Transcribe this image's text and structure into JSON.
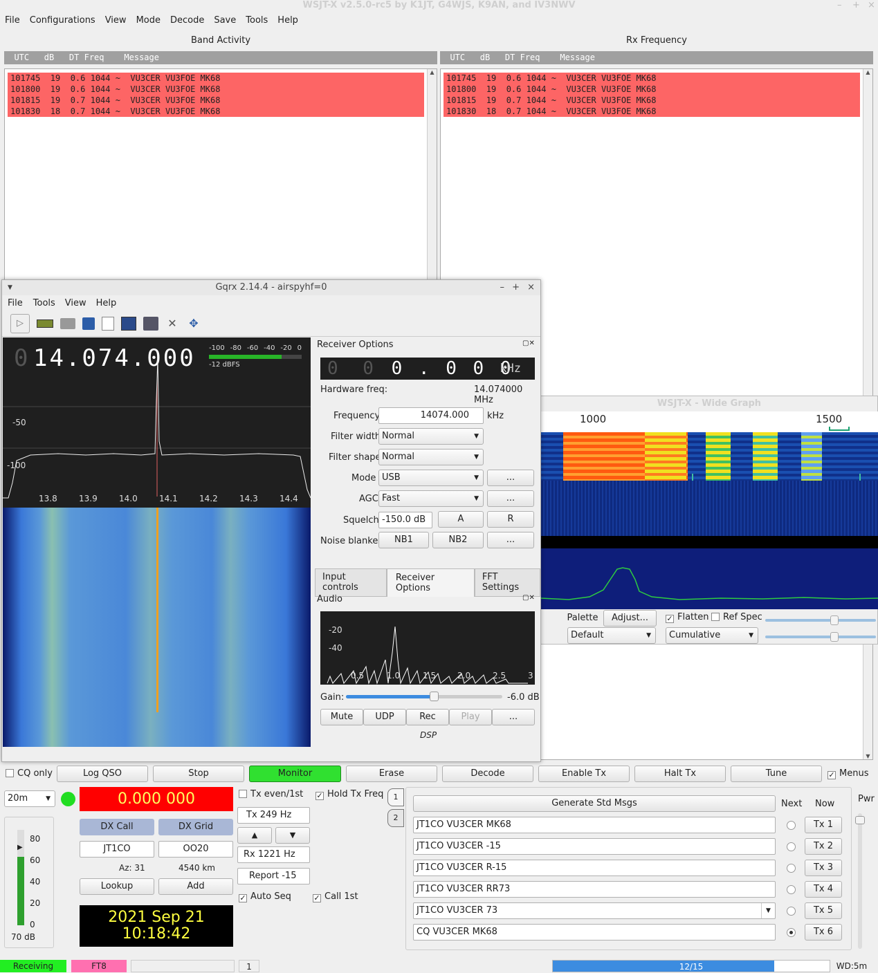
{
  "app_title": "WSJT-X   v2.5.0-rc5   by K1JT, G4WJS, K9AN, and IV3NWV",
  "menu": [
    "File",
    "Configurations",
    "View",
    "Mode",
    "Decode",
    "Save",
    "Tools",
    "Help"
  ],
  "band_activity": {
    "title": "Band Activity",
    "header": "  UTC   dB   DT Freq    Message",
    "rows": [
      "101745  19  0.6 1044 ~  VU3CER VU3FOE MK68",
      "101800  19  0.6 1044 ~  VU3CER VU3FOE MK68",
      "101815  19  0.7 1044 ~  VU3CER VU3FOE MK68",
      "101830  18  0.7 1044 ~  VU3CER VU3FOE MK68"
    ]
  },
  "rx_frequency": {
    "title": "Rx Frequency",
    "header": "  UTC   dB   DT Freq    Message",
    "rows": [
      "101745  19  0.6 1044 ~  VU3CER VU3FOE MK68",
      "101800  19  0.6 1044 ~  VU3CER VU3FOE MK68",
      "101815  19  0.7 1044 ~  VU3CER VU3FOE MK68",
      "101830  18  0.7 1044 ~  VU3CER VU3FOE MK68"
    ]
  },
  "gqrx": {
    "title": "Gqrx 2.14.4 - airspyhf=0",
    "menu": [
      "File",
      "Tools",
      "View",
      "Help"
    ],
    "freq_dim": "0",
    "freq_main": "14.074.000",
    "meter_scale": [
      "-100",
      "-80",
      "-60",
      "-40",
      "-20",
      "0"
    ],
    "meter_label": "-12 dBFS",
    "meter_level_fraction": 0.78,
    "spectrum_y": [
      "-50",
      "-100"
    ],
    "spectrum_x": [
      "13.8",
      "13.9",
      "14.0",
      "14.1",
      "14.2",
      "14.3",
      "14.4"
    ],
    "receiver_options": {
      "title": "Receiver Options",
      "offset_dim": "0 0",
      "offset_main": "0 . 0 0 0",
      "offset_unit": "kHz",
      "hw_label": "Hardware freq:",
      "hw_value": "14.074000 MHz",
      "frequency_label": "Frequency",
      "frequency_value": "14074.000",
      "frequency_unit": "kHz",
      "filter_width_label": "Filter width",
      "filter_width": "Normal",
      "filter_shape_label": "Filter shape",
      "filter_shape": "Normal",
      "mode_label": "Mode",
      "mode": "USB",
      "agc_label": "AGC",
      "agc": "Fast",
      "squelch_label": "Squelch",
      "squelch": "-150.0 dB",
      "btn_a": "A",
      "btn_r": "R",
      "nb_label": "Noise blanker",
      "nb1": "NB1",
      "nb2": "NB2",
      "more": "..."
    },
    "tabs": [
      "Input controls",
      "Receiver Options",
      "FFT Settings"
    ],
    "audio": {
      "title": "Audio",
      "y": [
        "-20",
        "-40"
      ],
      "x": [
        "0.5",
        "1.0",
        "1.5",
        "2.0",
        "2.5",
        "3"
      ],
      "gain_label": "Gain:",
      "gain_value": "-6.0 dB",
      "gain_fraction": 0.56,
      "buttons": [
        "Mute",
        "UDP",
        "Rec",
        "Play",
        "..."
      ],
      "dsp": "DSP"
    }
  },
  "wide_graph": {
    "title": "WSJT-X - Wide Graph",
    "scale": [
      "1000",
      "1500"
    ],
    "palette_label": "Palette",
    "adjust": "Adjust...",
    "flatten": "Flatten",
    "ref_spec": "Ref Spec",
    "palette_value": "Default",
    "cumulative": "Cumulative"
  },
  "controls": {
    "cq_only": "CQ only",
    "log_qso": "Log QSO",
    "stop": "Stop",
    "monitor": "Monitor",
    "erase": "Erase",
    "decode": "Decode",
    "enable_tx": "Enable Tx",
    "halt_tx": "Halt Tx",
    "tune": "Tune",
    "menus": "Menus",
    "band": "20m",
    "dial_freq": "0.000 000",
    "dx_call_label": "DX Call",
    "dx_grid_label": "DX Grid",
    "dx_call": "JT1CO",
    "dx_grid": "OO20",
    "az": "Az: 31",
    "distance": "4540 km",
    "lookup": "Lookup",
    "add": "Add",
    "date": "2021 Sep 21",
    "time": "10:18:42",
    "level_scale": [
      "80",
      "60",
      "40",
      "20",
      "0"
    ],
    "level_label": "70 dB",
    "level_fraction": 0.72,
    "tx_even": "Tx even/1st",
    "hold_tx": "Hold Tx Freq",
    "tx_freq": "Tx  249  Hz",
    "rx_freq": "Rx  1221  Hz",
    "report": "Report -15",
    "auto_seq": "Auto Seq",
    "call_1st": "Call 1st",
    "tab1": "1",
    "tab2": "2",
    "generate": "Generate Std Msgs",
    "next": "Next",
    "now": "Now",
    "pwr": "Pwr",
    "messages": [
      {
        "text": "JT1CO VU3CER MK68",
        "btn": "Tx 1"
      },
      {
        "text": "JT1CO VU3CER -15",
        "btn": "Tx 2"
      },
      {
        "text": "JT1CO VU3CER R-15",
        "btn": "Tx 3"
      },
      {
        "text": "JT1CO VU3CER RR73",
        "btn": "Tx 4"
      },
      {
        "text": "JT1CO VU3CER 73",
        "btn": "Tx 5"
      },
      {
        "text": "CQ VU3CER MK68",
        "btn": "Tx 6"
      }
    ]
  },
  "statusbar": {
    "state": "Receiving",
    "mode": "FT8",
    "num": "1",
    "progress": "12/15",
    "progress_fraction": 0.8,
    "wd": "WD:5m"
  }
}
